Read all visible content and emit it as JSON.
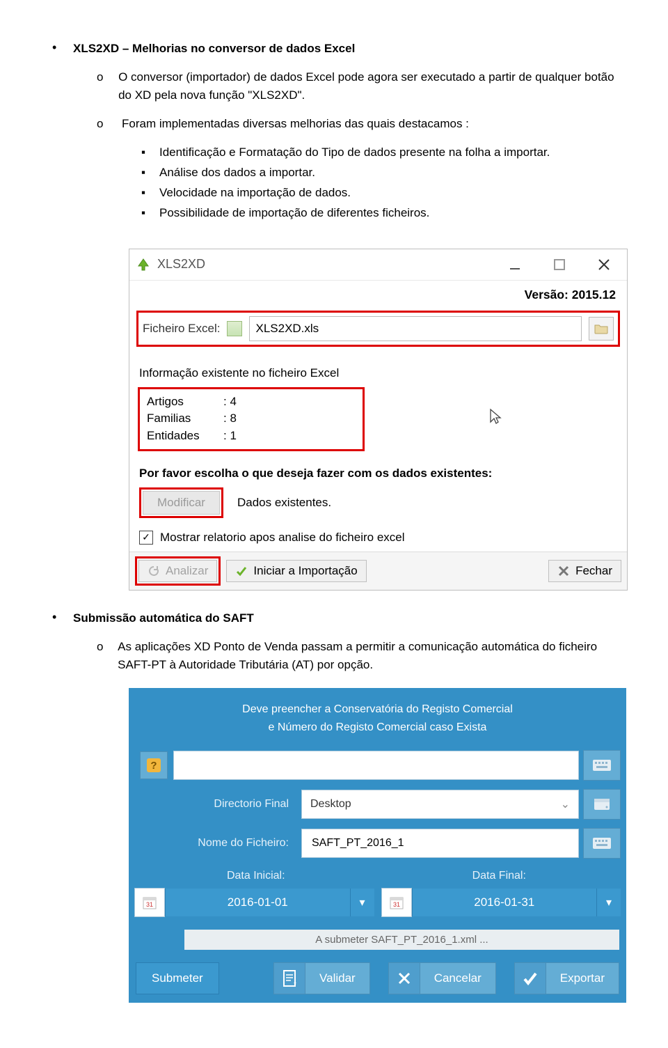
{
  "doc": {
    "sec1_title": "XLS2XD – Melhorias no conversor de dados Excel",
    "sec1_p1": "O conversor (importador) de dados Excel pode agora ser executado a partir de qualquer botão do XD pela nova função \"XLS2XD\".",
    "sec1_p2": "Foram implementadas diversas melhorias das quais destacamos :",
    "sec1_b1": "Identificação e Formatação do Tipo de dados presente na folha a importar.",
    "sec1_b2": "Análise dos dados a importar.",
    "sec1_b3": "Velocidade na importação de dados.",
    "sec1_b4": "Possibilidade de importação de diferentes ficheiros.",
    "sec2_title": "Submissão automática do SAFT",
    "sec2_p1": "As aplicações XD Ponto de Venda passam a permitir a comunicação automática do ficheiro SAFT-PT à Autoridade Tributária (AT) por opção."
  },
  "xls": {
    "title": "XLS2XD",
    "version_lbl": "Versão: 2015.12",
    "file_lbl": "Ficheiro Excel:",
    "file_val": "XLS2XD.xls",
    "info_lbl": "Informação existente no ficheiro Excel",
    "rows": [
      {
        "k": "Artigos",
        "v": ": 4"
      },
      {
        "k": "Familias",
        "v": ": 8"
      },
      {
        "k": "Entidades",
        "v": ": 1"
      }
    ],
    "prompt": "Por favor escolha o que deseja fazer com os dados existentes:",
    "modify_btn": "Modificar",
    "exist_lbl": "Dados existentes.",
    "chk_lbl": "Mostrar relatorio apos analise do ficheiro excel",
    "analyze": "Analizar",
    "import": "Iniciar a Importação",
    "close": "Fechar"
  },
  "saft": {
    "head1": "Deve preencher a Conservatória do Registo Comercial",
    "head2": "e Número do Registo Comercial caso Exista",
    "dir_lbl": "Directorio Final",
    "dir_val": "Desktop",
    "name_lbl": "Nome do Ficheiro:",
    "name_val": "SAFT_PT_2016_1",
    "di_lbl": "Data Inicial:",
    "df_lbl": "Data Final:",
    "di_val": "2016-01-01",
    "df_val": "2016-01-31",
    "msg": "A submeter SAFT_PT_2016_1.xml ...",
    "submit": "Submeter",
    "valid": "Validar",
    "cancel": "Cancelar",
    "export": "Exportar"
  }
}
